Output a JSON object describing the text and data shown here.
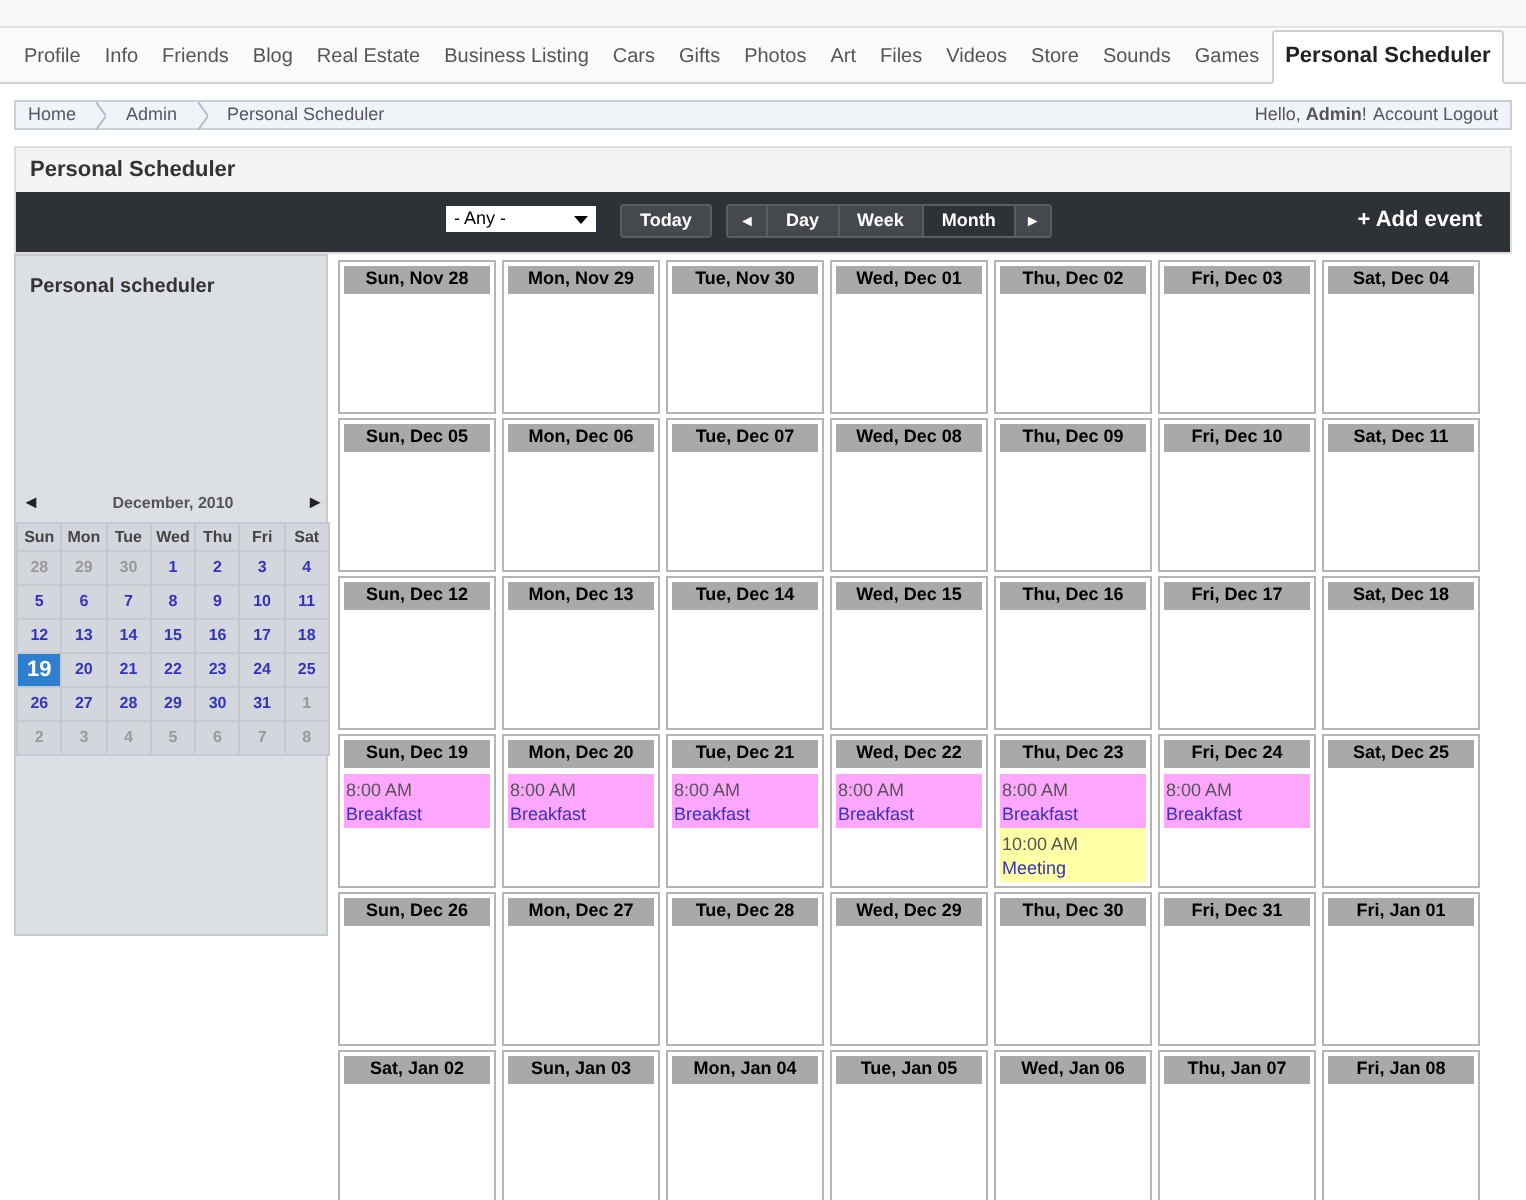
{
  "nav_tabs": [
    {
      "label": "Profile",
      "selected": false
    },
    {
      "label": "Info",
      "selected": false
    },
    {
      "label": "Friends",
      "selected": false
    },
    {
      "label": "Blog",
      "selected": false
    },
    {
      "label": "Real Estate",
      "selected": false
    },
    {
      "label": "Business Listing",
      "selected": false
    },
    {
      "label": "Cars",
      "selected": false
    },
    {
      "label": "Gifts",
      "selected": false
    },
    {
      "label": "Photos",
      "selected": false
    },
    {
      "label": "Art",
      "selected": false
    },
    {
      "label": "Files",
      "selected": false
    },
    {
      "label": "Videos",
      "selected": false
    },
    {
      "label": "Store",
      "selected": false
    },
    {
      "label": "Sounds",
      "selected": false
    },
    {
      "label": "Games",
      "selected": false
    },
    {
      "label": "Personal Scheduler",
      "selected": true
    }
  ],
  "breadcrumb": [
    "Home",
    "Admin",
    "Personal Scheduler"
  ],
  "user_bar": {
    "greeting": "Hello, **Admin**!",
    "link": "Account Logout"
  },
  "panel_title": "Personal Scheduler",
  "toolbar": {
    "filter": "- Any -",
    "today": "Today",
    "prev": "◄",
    "next": "►",
    "views": [
      {
        "label": "Day",
        "selected": false
      },
      {
        "label": "Week",
        "selected": false
      },
      {
        "label": "Month",
        "selected": true
      }
    ],
    "add": "+ Add event"
  },
  "sidebar": {
    "title": "Personal scheduler",
    "mini_calendar": {
      "prev": "◄",
      "next": "►",
      "month": "December, 2010",
      "weekdays": [
        "Sun",
        "Mon",
        "Tue",
        "Wed",
        "Thu",
        "Fri",
        "Sat"
      ],
      "days": [
        {
          "label": "28",
          "kind": "other",
          "selected": false
        },
        {
          "label": "29",
          "kind": "other",
          "selected": false
        },
        {
          "label": "30",
          "kind": "other",
          "selected": false
        },
        {
          "label": "1",
          "kind": "day",
          "selected": false
        },
        {
          "label": "2",
          "kind": "day",
          "selected": false
        },
        {
          "label": "3",
          "kind": "day",
          "selected": false
        },
        {
          "label": "4",
          "kind": "day",
          "selected": false
        },
        {
          "label": "5",
          "kind": "day",
          "selected": false
        },
        {
          "label": "6",
          "kind": "day",
          "selected": false
        },
        {
          "label": "7",
          "kind": "day",
          "selected": false
        },
        {
          "label": "8",
          "kind": "day",
          "selected": false
        },
        {
          "label": "9",
          "kind": "day",
          "selected": false
        },
        {
          "label": "10",
          "kind": "day",
          "selected": false
        },
        {
          "label": "11",
          "kind": "day",
          "selected": false
        },
        {
          "label": "12",
          "kind": "day",
          "selected": false
        },
        {
          "label": "13",
          "kind": "day",
          "selected": false
        },
        {
          "label": "14",
          "kind": "day",
          "selected": false
        },
        {
          "label": "15",
          "kind": "day",
          "selected": false
        },
        {
          "label": "16",
          "kind": "day",
          "selected": false
        },
        {
          "label": "17",
          "kind": "day",
          "selected": false
        },
        {
          "label": "18",
          "kind": "day",
          "selected": false
        },
        {
          "label": "19",
          "kind": "day",
          "selected": true
        },
        {
          "label": "20",
          "kind": "day",
          "selected": false
        },
        {
          "label": "21",
          "kind": "day",
          "selected": false
        },
        {
          "label": "22",
          "kind": "day",
          "selected": false
        },
        {
          "label": "23",
          "kind": "day",
          "selected": false
        },
        {
          "label": "24",
          "kind": "day",
          "selected": false
        },
        {
          "label": "25",
          "kind": "day",
          "selected": false
        },
        {
          "label": "26",
          "kind": "day",
          "selected": false
        },
        {
          "label": "27",
          "kind": "day",
          "selected": false
        },
        {
          "label": "28",
          "kind": "day",
          "selected": false
        },
        {
          "label": "29",
          "kind": "day",
          "selected": false
        },
        {
          "label": "30",
          "kind": "day",
          "selected": false
        },
        {
          "label": "31",
          "kind": "day",
          "selected": false
        },
        {
          "label": "1",
          "kind": "other",
          "selected": false
        },
        {
          "label": "2",
          "kind": "other",
          "selected": false
        },
        {
          "label": "3",
          "kind": "other",
          "selected": false
        },
        {
          "label": "4",
          "kind": "other",
          "selected": false
        },
        {
          "label": "5",
          "kind": "other",
          "selected": false
        },
        {
          "label": "6",
          "kind": "other",
          "selected": false
        },
        {
          "label": "7",
          "kind": "other",
          "selected": false
        },
        {
          "label": "8",
          "kind": "other",
          "selected": false
        }
      ]
    }
  },
  "calendar": [
    {
      "date": "Sun, Nov 28"
    },
    {
      "date": "Mon, Nov 29"
    },
    {
      "date": "Tue, Nov 30"
    },
    {
      "date": "Wed, Dec 01"
    },
    {
      "date": "Thu, Dec 02"
    },
    {
      "date": "Fri, Dec 03"
    },
    {
      "date": "Sat, Dec 04"
    },
    {
      "date": "Sun, Dec 05"
    },
    {
      "date": "Mon, Dec 06"
    },
    {
      "date": "Tue, Dec 07"
    },
    {
      "date": "Wed, Dec 08"
    },
    {
      "date": "Thu, Dec 09"
    },
    {
      "date": "Fri, Dec 10"
    },
    {
      "date": "Sat, Dec 11"
    },
    {
      "date": "Sun, Dec 12"
    },
    {
      "date": "Mon, Dec 13"
    },
    {
      "date": "Tue, Dec 14"
    },
    {
      "date": "Wed, Dec 15"
    },
    {
      "date": "Thu, Dec 16"
    },
    {
      "date": "Fri, Dec 17"
    },
    {
      "date": "Sat, Dec 18"
    },
    {
      "date": "Sun, Dec 19",
      "events": [
        {
          "time": "8:00 AM",
          "title": "Breakfast",
          "color": "#ffa6ff"
        }
      ]
    },
    {
      "date": "Mon, Dec 20",
      "events": [
        {
          "time": "8:00 AM",
          "title": "Breakfast",
          "color": "#ffa6ff"
        }
      ]
    },
    {
      "date": "Tue, Dec 21",
      "events": [
        {
          "time": "8:00 AM",
          "title": "Breakfast",
          "color": "#ffa6ff"
        }
      ]
    },
    {
      "date": "Wed, Dec 22",
      "events": [
        {
          "time": "8:00 AM",
          "title": "Breakfast",
          "color": "#ffa6ff"
        }
      ]
    },
    {
      "date": "Thu, Dec 23",
      "events": [
        {
          "time": "8:00 AM",
          "title": "Breakfast",
          "color": "#ffa6ff"
        },
        {
          "time": "10:00 AM",
          "title": "Meeting",
          "color": "#ffffa6"
        }
      ]
    },
    {
      "date": "Fri, Dec 24",
      "events": [
        {
          "time": "8:00 AM",
          "title": "Breakfast",
          "color": "#ffa6ff"
        }
      ]
    },
    {
      "date": "Sat, Dec 25"
    },
    {
      "date": "Sun, Dec 26"
    },
    {
      "date": "Mon, Dec 27"
    },
    {
      "date": "Tue, Dec 28"
    },
    {
      "date": "Wed, Dec 29"
    },
    {
      "date": "Thu, Dec 30"
    },
    {
      "date": "Fri, Dec 31"
    },
    {
      "date": "Fri, Jan 01"
    },
    {
      "date": "Sat, Jan 02"
    },
    {
      "date": "Sun, Jan 03"
    },
    {
      "date": "Mon, Jan 04"
    },
    {
      "date": "Tue, Jan 05"
    },
    {
      "date": "Wed, Jan 06"
    },
    {
      "date": "Thu, Jan 07"
    },
    {
      "date": "Fri, Jan 08"
    }
  ]
}
